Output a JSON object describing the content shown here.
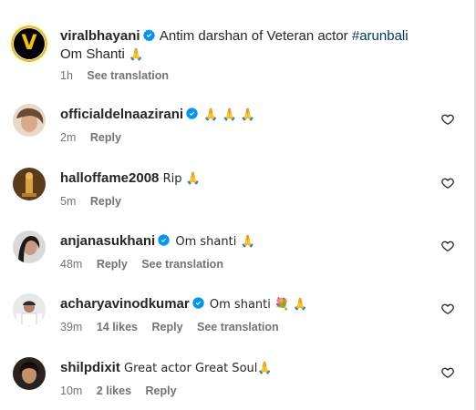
{
  "caption": {
    "username": "viralbhayani",
    "text": "Antim darshan of Veteran actor",
    "hashtag": "#arunbali",
    "line2": "Om Shanti",
    "emoji": "🙏",
    "time": "1h",
    "translate": "See translation"
  },
  "comments": [
    {
      "username": "officialdelnaazirani",
      "verified": true,
      "text": "🙏 🙏 🙏",
      "time": "2m",
      "likes": "",
      "reply": "Reply",
      "translate": ""
    },
    {
      "username": "halloffame2008",
      "verified": false,
      "text": "Rip 🙏",
      "time": "5m",
      "likes": "",
      "reply": "Reply",
      "translate": ""
    },
    {
      "username": "anjanasukhani",
      "verified": true,
      "text": "Om shanti 🙏",
      "time": "48m",
      "likes": "",
      "reply": "Reply",
      "translate": "See translation"
    },
    {
      "username": "acharyavinodkumar",
      "verified": true,
      "text": "Om shanti 💐 🙏",
      "time": "39m",
      "likes": "14 likes",
      "reply": "Reply",
      "translate": "See translation"
    },
    {
      "username": "shilpdixit",
      "verified": false,
      "text": "Great actor Great Soul🙏",
      "time": "10m",
      "likes": "2 likes",
      "reply": "Reply",
      "translate": ""
    }
  ],
  "colors": {
    "verified": "#0095f6",
    "meta": "#737373",
    "hashtag": "#00376b",
    "text": "#262626"
  },
  "icons": {
    "like": "heart-outline-icon",
    "verified": "verified-badge-icon"
  }
}
